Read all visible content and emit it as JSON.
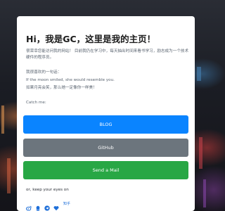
{
  "card": {
    "title": "Hi，我是GC，这里是我的主页！",
    "intro": "很荣幸您能访问我的网站！ 目前我仍在学习中，每天抽出时间来看书学习，励志成为一个技术硬件的程序员。",
    "quote_label": "我很喜欢的一句话：",
    "quote_en": "If the moon smiled, she would resemble you.",
    "quote_cn": "如果月亮会笑，那么她一定像你一样美！",
    "catch_label": "Catch me:"
  },
  "buttons": {
    "blog": "BLOG",
    "github": "GitHub",
    "mail": "Send a Mail"
  },
  "eyes_label": "or, keep your eyes on",
  "social": {
    "icons": [
      "weibo-icon",
      "qq-icon",
      "telegram-icon",
      "heart-icon",
      "zhihu-icon"
    ],
    "zhihu_label": "知乎"
  },
  "colors": {
    "blog": "#0a84ff",
    "github": "#6c757d",
    "mail": "#28a745"
  }
}
